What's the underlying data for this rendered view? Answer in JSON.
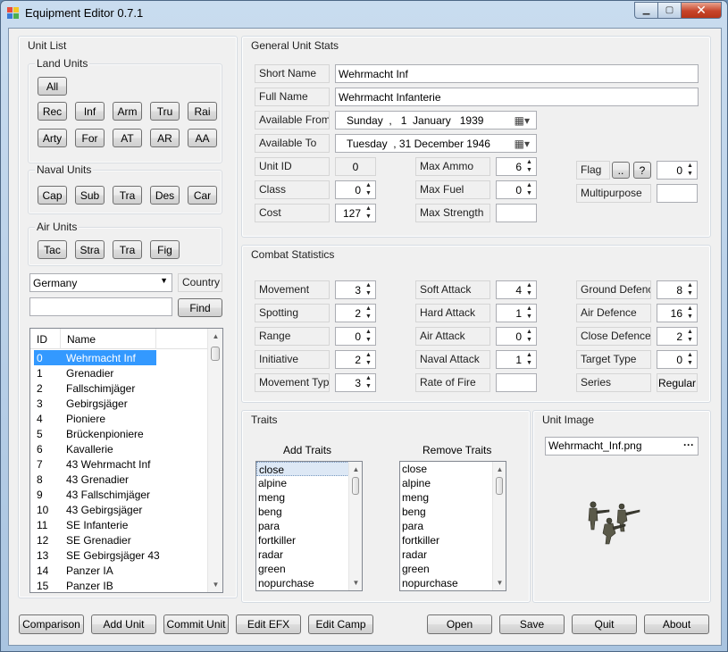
{
  "window": {
    "title": "Equipment Editor 0.7.1"
  },
  "unit_list": {
    "title": "Unit List",
    "land": {
      "title": "Land Units",
      "all": "All",
      "row1": [
        "Rec",
        "Inf",
        "Arm",
        "Tru",
        "Rai"
      ],
      "row2": [
        "Arty",
        "For",
        "AT",
        "AR",
        "AA"
      ]
    },
    "naval": {
      "title": "Naval Units",
      "buttons": [
        "Cap",
        "Sub",
        "Tra",
        "Des",
        "Car"
      ]
    },
    "air": {
      "title": "Air Units",
      "buttons": [
        "Tac",
        "Stra",
        "Tra",
        "Fig"
      ]
    },
    "country_select": "Germany",
    "country_label": "Country",
    "search_value": "",
    "find_button": "Find",
    "grid": {
      "columns": [
        "ID",
        "Name"
      ],
      "rows": [
        [
          "0",
          "Wehrmacht Inf"
        ],
        [
          "1",
          "Grenadier"
        ],
        [
          "2",
          "Fallschimjäger"
        ],
        [
          "3",
          "Gebirgsjäger"
        ],
        [
          "4",
          "Pioniere"
        ],
        [
          "5",
          "Brückenpioniere"
        ],
        [
          "6",
          "Kavallerie"
        ],
        [
          "7",
          "43 Wehrmacht Inf"
        ],
        [
          "8",
          "43 Grenadier"
        ],
        [
          "9",
          "43 Fallschimjäger"
        ],
        [
          "10",
          "43 Gebirgsjäger"
        ],
        [
          "11",
          "SE Infanterie"
        ],
        [
          "12",
          "SE Grenadier"
        ],
        [
          "13",
          "SE Gebirgsjäger 43"
        ],
        [
          "14",
          "Panzer IA"
        ],
        [
          "15",
          "Panzer IB"
        ]
      ]
    }
  },
  "general": {
    "title": "General Unit Stats",
    "short_name_label": "Short Name",
    "short_name": "Wehrmacht Inf",
    "full_name_label": "Full Name",
    "full_name": "Wehrmacht Infanterie",
    "available_from_label": "Available From",
    "available_from": "Sunday  ,   1  January   1939",
    "available_to_label": "Available To",
    "available_to": "Tuesday  , 31 December 1946",
    "unit_id_label": "Unit ID",
    "unit_id": "0",
    "class_label": "Class",
    "class": "0",
    "cost_label": "Cost",
    "cost": "127",
    "max_ammo_label": "Max Ammo",
    "max_ammo": "6",
    "max_fuel_label": "Max Fuel",
    "max_fuel": "0",
    "max_strength_label": "Max Strength",
    "max_strength": "",
    "flag_label": "Flag",
    "flag_browse": "..",
    "flag_help": "?",
    "flag": "0",
    "multipurpose_label": "Multipurpose",
    "multipurpose": ""
  },
  "combat": {
    "title": "Combat Statistics",
    "col1": [
      {
        "label": "Movement",
        "value": "3"
      },
      {
        "label": "Spotting",
        "value": "2"
      },
      {
        "label": "Range",
        "value": "0"
      },
      {
        "label": "Initiative",
        "value": "2"
      },
      {
        "label": "Movement Type",
        "value": "3"
      }
    ],
    "col2": [
      {
        "label": "Soft Attack",
        "value": "4"
      },
      {
        "label": "Hard Attack",
        "value": "1"
      },
      {
        "label": "Air Attack",
        "value": "0"
      },
      {
        "label": "Naval Attack",
        "value": "1"
      }
    ],
    "rate_of_fire_label": "Rate of Fire",
    "rate_of_fire": "",
    "col3": [
      {
        "label": "Ground Defence",
        "value": "8"
      },
      {
        "label": "Air Defence",
        "value": "16"
      },
      {
        "label": "Close Defence",
        "value": "2"
      },
      {
        "label": "Target Type",
        "value": "0"
      }
    ],
    "series_label": "Series",
    "series": "Regular"
  },
  "traits": {
    "title": "Traits",
    "add_label": "Add Traits",
    "remove_label": "Remove Traits",
    "items": [
      "close",
      "alpine",
      "meng",
      "beng",
      "para",
      "fortkiller",
      "radar",
      "green",
      "nopurchase"
    ]
  },
  "unit_image": {
    "title": "Unit Image",
    "file": "Wehrmacht_Inf.png",
    "browse": "···"
  },
  "bottom": {
    "left": [
      "Comparison",
      "Add Unit",
      "Commit Unit",
      "Edit EFX",
      "Edit Camp"
    ],
    "right": [
      "Open",
      "Save",
      "Quit",
      "About"
    ]
  },
  "colors": {
    "selection": "#3399ff",
    "window_frame": "#a9c4e0",
    "close_button": "#c7442a"
  }
}
